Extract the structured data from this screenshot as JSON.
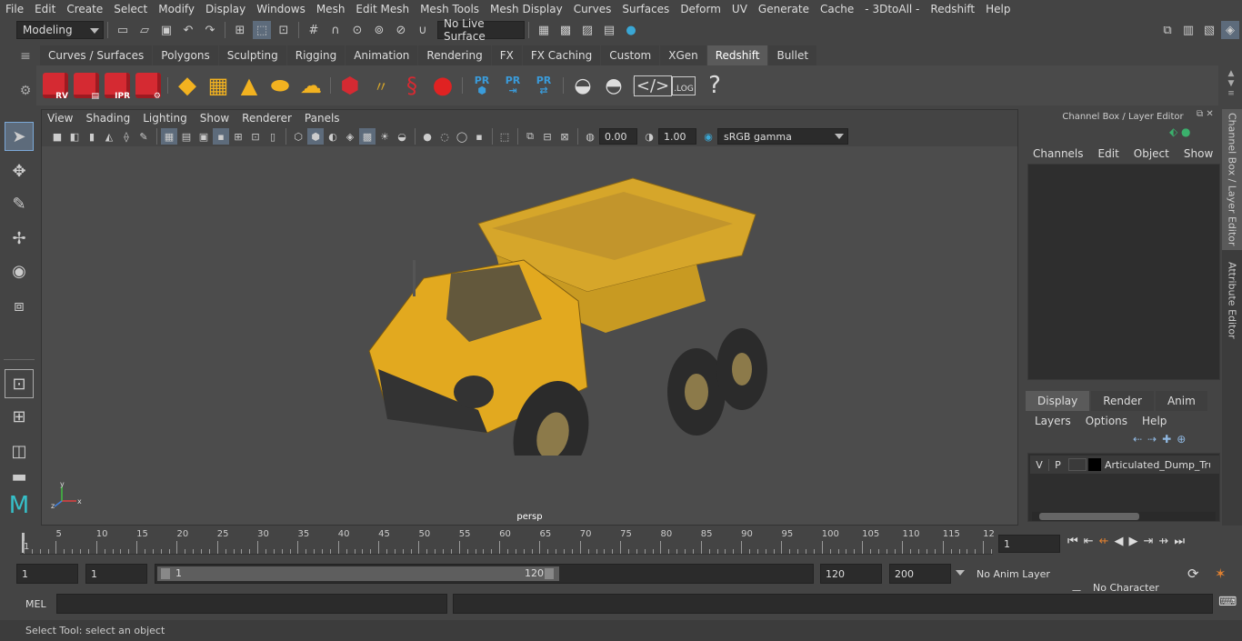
{
  "menubar": {
    "items": [
      "File",
      "Edit",
      "Create",
      "Select",
      "Modify",
      "Display",
      "Windows",
      "Mesh",
      "Edit Mesh",
      "Mesh Tools",
      "Mesh Display",
      "Curves",
      "Surfaces",
      "Deform",
      "UV",
      "Generate",
      "Cache",
      "- 3DtoAll -",
      "Redshift",
      "Help"
    ]
  },
  "statusline": {
    "mode": "Modeling",
    "live_surface": "No Live Surface"
  },
  "shelf": {
    "tabs": [
      "Curves / Surfaces",
      "Polygons",
      "Sculpting",
      "Rigging",
      "Animation",
      "Rendering",
      "FX",
      "FX Caching",
      "Custom",
      "XGen",
      "Redshift",
      "Bullet"
    ],
    "active_tab": "Redshift",
    "rs_labels": [
      "RV",
      "",
      "IPR",
      ""
    ],
    "pr_label": "PR",
    "log_label": ".LOG",
    "help_glyph": "?"
  },
  "viewport": {
    "menus": [
      "View",
      "Shading",
      "Lighting",
      "Show",
      "Renderer",
      "Panels"
    ],
    "exposure": "0.00",
    "gamma": "1.00",
    "color_space": "sRGB gamma",
    "camera_label": "persp",
    "axis_x": "x",
    "axis_y": "y",
    "axis_z": "z"
  },
  "channel_box": {
    "title": "Channel Box / Layer Editor",
    "menus": [
      "Channels",
      "Edit",
      "Object",
      "Show"
    ]
  },
  "layer_editor": {
    "tabs": [
      "Display",
      "Render",
      "Anim"
    ],
    "active_tab": "Display",
    "menus": [
      "Layers",
      "Options",
      "Help"
    ],
    "layer": {
      "v": "V",
      "p": "P",
      "name": "Articulated_Dump_Tru"
    }
  },
  "side_tabs": [
    "Channel Box / Layer Editor",
    "Attribute Editor"
  ],
  "timeline": {
    "ticks": [
      "1",
      "5",
      "10",
      "15",
      "20",
      "25",
      "30",
      "35",
      "40",
      "45",
      "50",
      "55",
      "60",
      "65",
      "70",
      "75",
      "80",
      "85",
      "90",
      "95",
      "100",
      "105",
      "110",
      "115",
      "12"
    ],
    "current_frame": "1"
  },
  "range": {
    "start": "1",
    "playback_start": "1",
    "slider_start": "1",
    "slider_end": "120",
    "playback_end": "120",
    "end": "200",
    "anim_layer": "No Anim Layer",
    "character_set": "No Character Set"
  },
  "command": {
    "lang": "MEL"
  },
  "help_text": "Select Tool: select an object",
  "colors": {
    "accent": "#7ca9d8",
    "redshift": "#d52a32",
    "truck_yellow": "#e2a91f"
  }
}
